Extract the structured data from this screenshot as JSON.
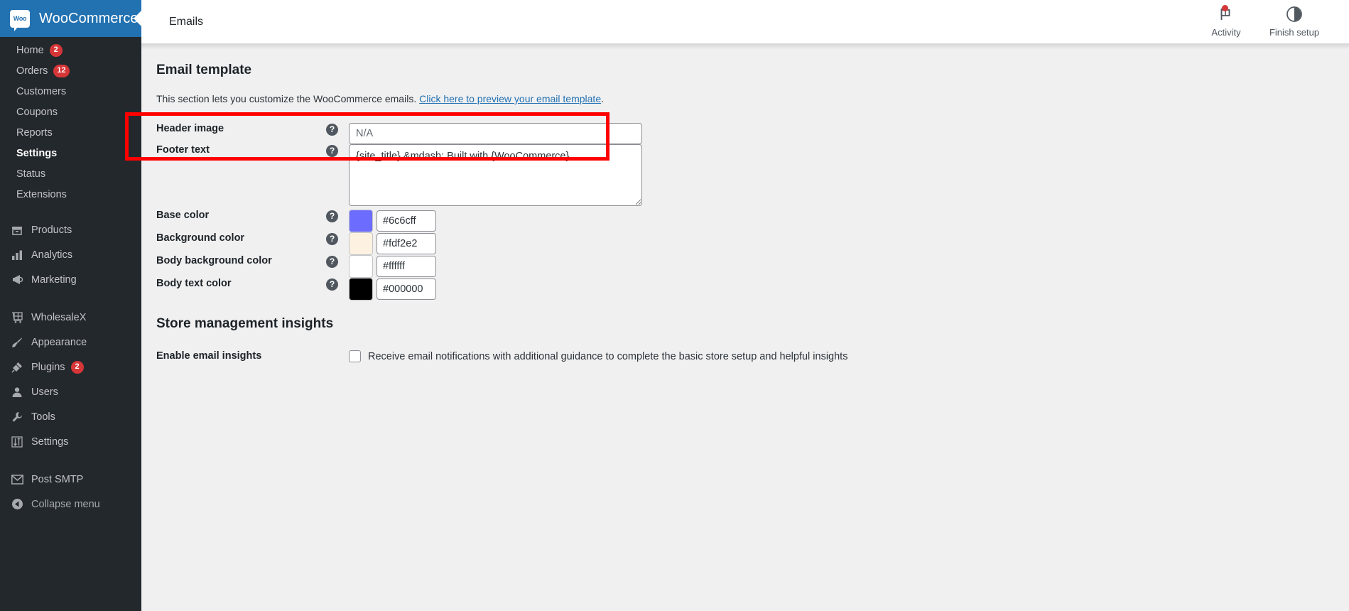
{
  "brand": {
    "name": "WooCommerce",
    "logo_text": "Woo"
  },
  "sidebar": {
    "primary": [
      {
        "label": "Home",
        "badge": "2",
        "icon": ""
      },
      {
        "label": "Orders",
        "badge": "12",
        "icon": ""
      },
      {
        "label": "Customers",
        "badge": "",
        "icon": ""
      },
      {
        "label": "Coupons",
        "badge": "",
        "icon": ""
      },
      {
        "label": "Reports",
        "badge": "",
        "icon": ""
      },
      {
        "label": "Settings",
        "badge": "",
        "icon": ""
      },
      {
        "label": "Status",
        "badge": "",
        "icon": ""
      },
      {
        "label": "Extensions",
        "badge": "",
        "icon": ""
      }
    ],
    "secondary": [
      {
        "label": "Products",
        "badge": "",
        "icon": "products-icon"
      },
      {
        "label": "Analytics",
        "badge": "",
        "icon": "analytics-icon"
      },
      {
        "label": "Marketing",
        "badge": "",
        "icon": "marketing-icon"
      }
    ],
    "tertiary": [
      {
        "label": "WholesaleX",
        "badge": "",
        "icon": "wholesalex-icon"
      },
      {
        "label": "Appearance",
        "badge": "",
        "icon": "appearance-icon"
      },
      {
        "label": "Plugins",
        "badge": "2",
        "icon": "plugins-icon"
      },
      {
        "label": "Users",
        "badge": "",
        "icon": "users-icon"
      },
      {
        "label": "Tools",
        "badge": "",
        "icon": "tools-icon"
      },
      {
        "label": "Settings",
        "badge": "",
        "icon": "settings-icon"
      }
    ],
    "quaternary": [
      {
        "label": "Post SMTP",
        "badge": "",
        "icon": "mail-icon"
      }
    ],
    "collapse_label": "Collapse menu"
  },
  "topbar": {
    "title": "Emails",
    "activity_label": "Activity",
    "finish_setup_label": "Finish setup"
  },
  "main": {
    "section_title": "Email template",
    "description_prefix": "This section lets you customize the WooCommerce emails. ",
    "description_link": "Click here to preview your email template",
    "description_suffix": ".",
    "fields": {
      "header_image": {
        "label": "Header image",
        "value": "",
        "placeholder": "N/A",
        "help": "?"
      },
      "footer_text": {
        "label": "Footer text",
        "value": "{site_title} &mdash; Built with {WooCommerce}",
        "help": "?"
      },
      "base_color": {
        "label": "Base color",
        "value": "#6c6cff",
        "swatch": "#6c6cff",
        "help": "?"
      },
      "background_color": {
        "label": "Background color",
        "value": "#fdf2e2",
        "swatch": "#fdf2e2",
        "help": "?"
      },
      "body_background_color": {
        "label": "Body background color",
        "value": "#ffffff",
        "swatch": "#ffffff",
        "help": "?"
      },
      "body_text_color": {
        "label": "Body text color",
        "value": "#000000",
        "swatch": "#000000",
        "help": "?"
      }
    },
    "insights": {
      "section_title": "Store management insights",
      "label": "Enable email insights",
      "checkbox_label": "Receive email notifications with additional guidance to complete the basic store setup and helpful insights",
      "checked": false
    }
  },
  "highlight": {
    "color": "#ff0000"
  }
}
